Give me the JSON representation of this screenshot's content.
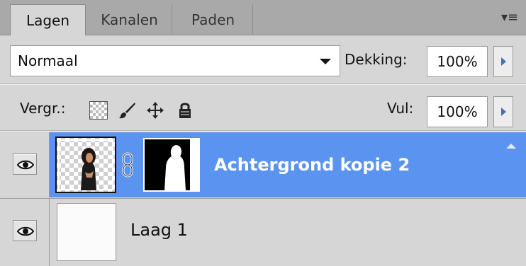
{
  "tabs": [
    {
      "label": "Lagen",
      "active": true
    },
    {
      "label": "Kanalen",
      "active": false
    },
    {
      "label": "Paden",
      "active": false
    }
  ],
  "panel_menu_icon": "panel-menu-icon",
  "blend": {
    "mode": "Normaal",
    "opacity_label": "Dekking:",
    "opacity_value": "100%"
  },
  "lock": {
    "label": "Vergr.:",
    "icons": [
      "lock-transparent-icon",
      "lock-brush-icon",
      "lock-move-icon",
      "lock-all-icon"
    ],
    "fill_label": "Vul:",
    "fill_value": "100%"
  },
  "layers": [
    {
      "name": "Achtergrond kopie 2",
      "visible": true,
      "selected": true,
      "has_mask": true
    },
    {
      "name": "Laag 1",
      "visible": true,
      "selected": false,
      "has_mask": false
    }
  ],
  "colors": {
    "selection": "#5b94f0",
    "panel": "#d6d6d6",
    "tabbar": "#a9a9a9"
  }
}
